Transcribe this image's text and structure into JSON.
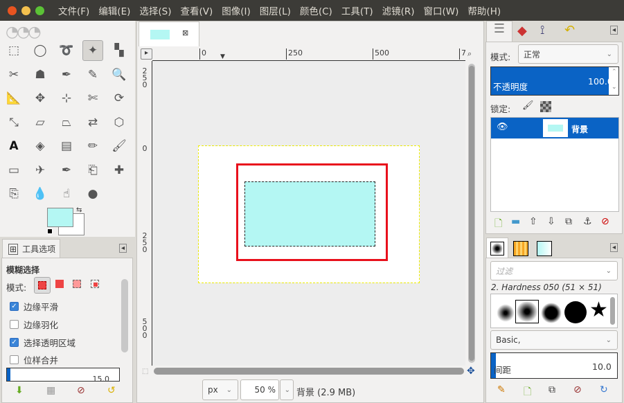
{
  "menubar": {
    "items": [
      "文件(F)",
      "编辑(E)",
      "选择(S)",
      "查看(V)",
      "图像(I)",
      "图层(L)",
      "颜色(C)",
      "工具(T)",
      "滤镜(R)",
      "窗口(W)",
      "帮助(H)"
    ]
  },
  "toolbox": {
    "tools": [
      "rect-select",
      "ellipse-select",
      "free-select",
      "fuzzy-select",
      "color-select",
      "scissors",
      "foreground-select",
      "paths",
      "color-picker",
      "zoom",
      "measure",
      "move",
      "align",
      "crop",
      "rotate",
      "scale",
      "shear",
      "perspective",
      "flip",
      "cage",
      "text",
      "bucket-fill",
      "blend",
      "pencil",
      "paintbrush",
      "eraser",
      "airbrush",
      "ink",
      "clone",
      "heal",
      "perspective-clone",
      "blur",
      "smudge",
      "dodge-burn"
    ],
    "fg_color": "#b4f7f3",
    "bg_color": "#ffffff"
  },
  "tool_options": {
    "tab_label": "工具选项",
    "title": "模糊选择",
    "mode_label": "模式:",
    "options": [
      {
        "label": "边缘平滑",
        "checked": true
      },
      {
        "label": "边缘羽化",
        "checked": false
      },
      {
        "label": "选择透明区域",
        "checked": true
      },
      {
        "label": "位样合并",
        "checked": false
      }
    ],
    "threshold_partial": "15.0"
  },
  "canvas": {
    "ruler_labels": [
      "0",
      "250",
      "500",
      "7"
    ],
    "vruler_labels": [
      "250",
      "0",
      "250",
      "500"
    ],
    "unit": "px",
    "zoom": "50 %",
    "status": "背景 (2.9 MB)",
    "image_fill": "#b4f7f3",
    "rect_color": "#e8101c"
  },
  "layers": {
    "mode_label": "模式:",
    "mode_value": "正常",
    "opacity_label": "不透明度",
    "opacity_value": "100.0",
    "opacity_fraction": 1.0,
    "lock_label": "锁定:",
    "layer_name": "背景",
    "accent": "#0a63c5"
  },
  "brushes": {
    "filter_placeholder": "过滤",
    "brush_name": "2. Hardness 050 (51 × 51)",
    "tag_value": "Basic,",
    "spacing_label": "间距",
    "spacing_value": "10.0"
  }
}
